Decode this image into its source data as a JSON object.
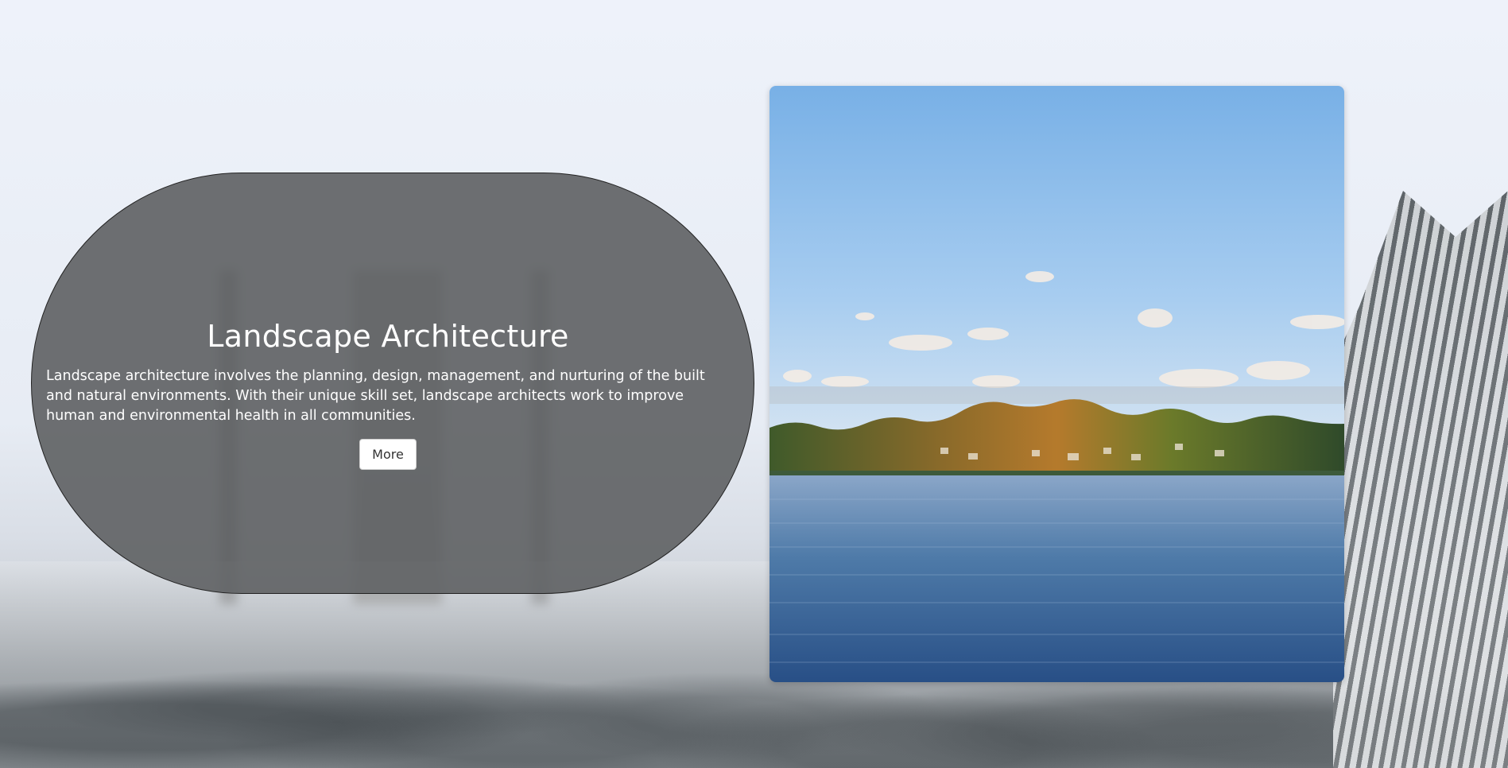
{
  "card": {
    "title": "Landscape Architecture",
    "description": "Landscape architecture involves the planning, design, management, and nurturing of the built and natural environments. With their unique skill set, landscape architects work to improve human and environmental health in all communities.",
    "button_label": "More"
  },
  "photo": {
    "subject": "lake-with-autumn-forest-shoreline"
  },
  "background": {
    "subject": "snowy-castle-forest"
  }
}
